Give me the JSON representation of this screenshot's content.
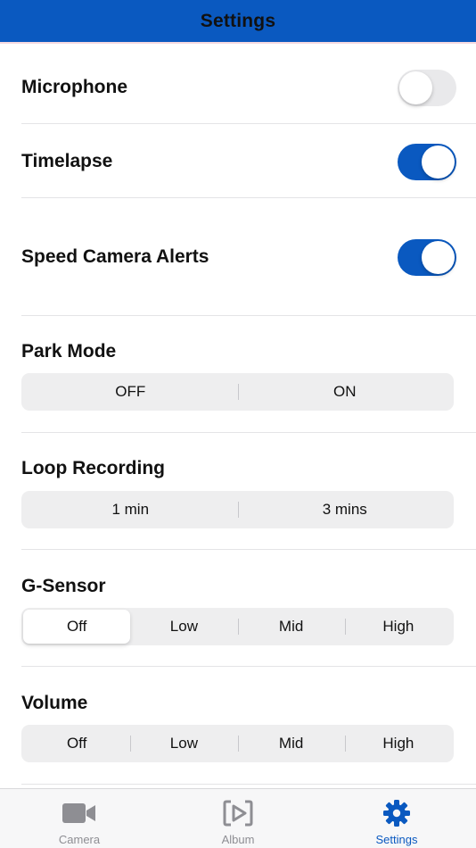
{
  "header": {
    "title": "Settings"
  },
  "toggles": [
    {
      "label": "Microphone",
      "on": false
    },
    {
      "label": "Timelapse",
      "on": true
    },
    {
      "label": "Speed Camera Alerts",
      "on": true
    }
  ],
  "park_mode": {
    "label": "Park Mode",
    "options": [
      "OFF",
      "ON"
    ],
    "selected": null
  },
  "loop_recording": {
    "label": "Loop Recording",
    "options": [
      "1 min",
      "3 mins"
    ],
    "selected": null
  },
  "g_sensor": {
    "label": "G-Sensor",
    "options": [
      "Off",
      "Low",
      "Mid",
      "High"
    ],
    "selected": "Off"
  },
  "volume": {
    "label": "Volume",
    "options": [
      "Off",
      "Low",
      "Mid",
      "High"
    ],
    "selected": null
  },
  "tabbar": {
    "items": [
      {
        "label": "Camera",
        "icon": "video-camera-icon",
        "active": false
      },
      {
        "label": "Album",
        "icon": "play-frame-icon",
        "active": false
      },
      {
        "label": "Settings",
        "icon": "gear-icon",
        "active": true
      }
    ]
  },
  "colors": {
    "accent": "#0a59c0",
    "toggle_off": "#e9e9eb",
    "inactive_tab": "#8e8e93"
  }
}
